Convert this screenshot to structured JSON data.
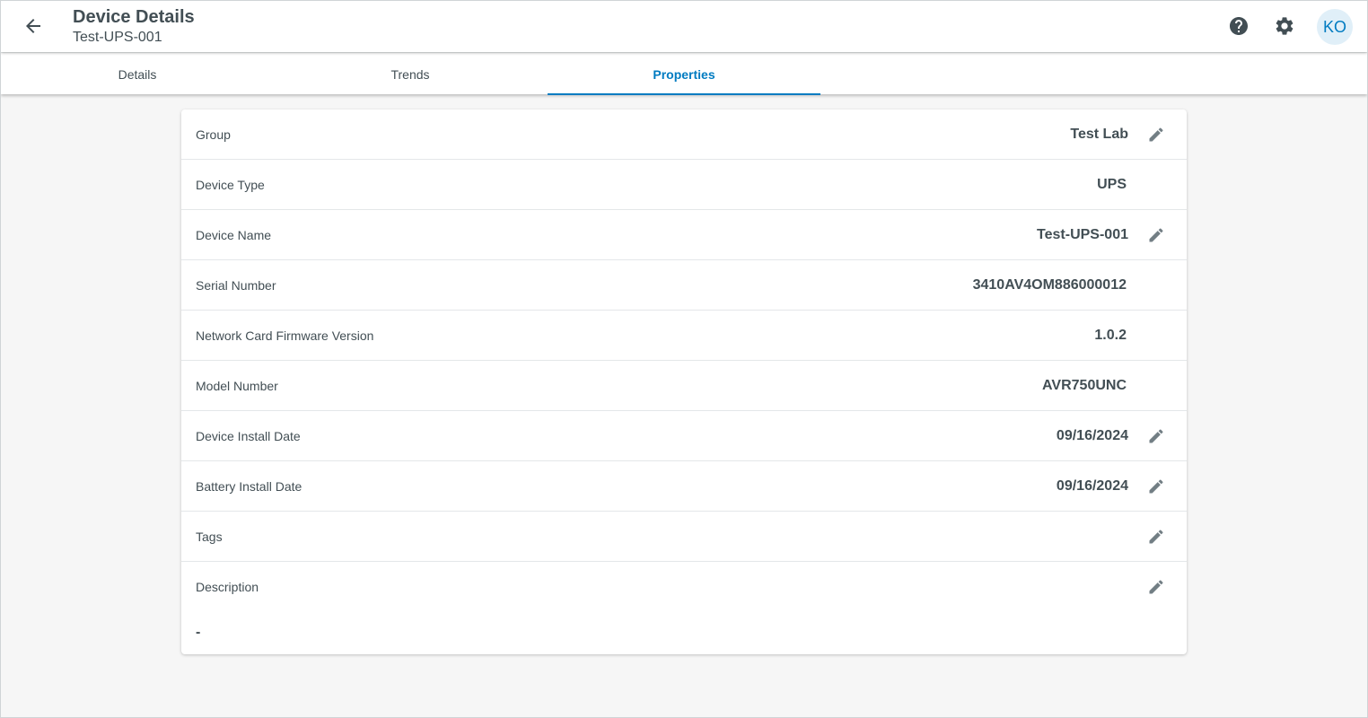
{
  "header": {
    "title": "Device Details",
    "subtitle": "Test-UPS-001",
    "avatar_initials": "KO",
    "icons": {
      "back": "arrow-back-icon",
      "help": "help-circle-icon",
      "settings": "gear-icon"
    }
  },
  "tabs": [
    {
      "label": "Details",
      "active": false
    },
    {
      "label": "Trends",
      "active": false
    },
    {
      "label": "Properties",
      "active": true
    }
  ],
  "properties": [
    {
      "label": "Group",
      "value": "Test Lab",
      "editable": true
    },
    {
      "label": "Device Type",
      "value": "UPS",
      "editable": false
    },
    {
      "label": "Device Name",
      "value": "Test-UPS-001",
      "editable": true
    },
    {
      "label": "Serial Number",
      "value": "3410AV4OM886000012",
      "editable": false
    },
    {
      "label": "Network Card Firmware Version",
      "value": "1.0.2",
      "editable": false
    },
    {
      "label": "Model Number",
      "value": "AVR750UNC",
      "editable": false
    },
    {
      "label": "Device Install Date",
      "value": "09/16/2024",
      "editable": true
    },
    {
      "label": "Battery Install Date",
      "value": "09/16/2024",
      "editable": true
    },
    {
      "label": "Tags",
      "value": "",
      "editable": true
    },
    {
      "label": "Description",
      "value": "-",
      "editable": true
    }
  ],
  "colors": {
    "accent": "#007bc1",
    "text": "#424e54",
    "icon": "#727e84",
    "background": "#f6f6f6"
  }
}
